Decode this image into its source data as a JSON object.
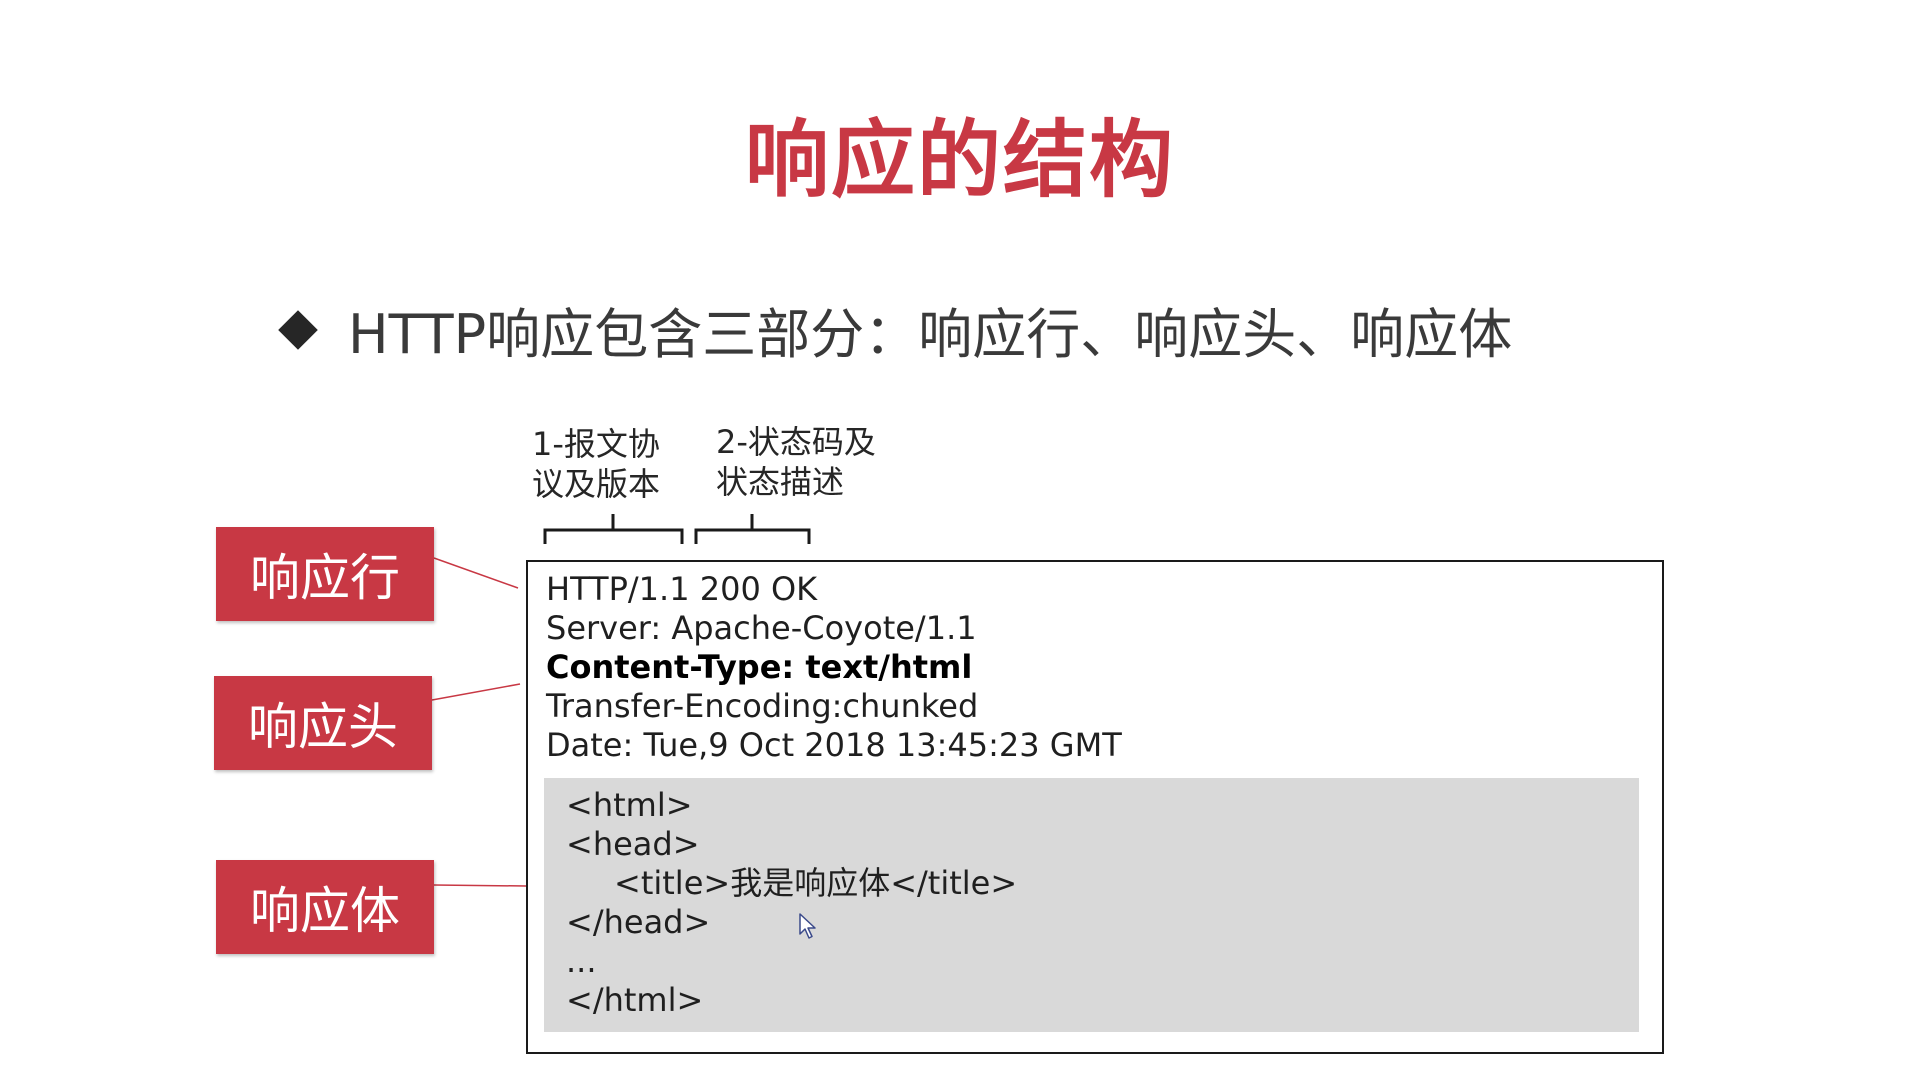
{
  "slide": {
    "title": "响应的结构",
    "bullet": "HTTP响应包含三部分：响应行、响应头、响应体",
    "annotations": {
      "protocol": [
        "1-报文协",
        "议及版本"
      ],
      "status": [
        "2-状态码及",
        "状态描述"
      ]
    },
    "labels": {
      "response_line": "响应行",
      "response_headers": "响应头",
      "response_body": "响应体"
    },
    "response": {
      "status_line": "HTTP/1.1 200 OK",
      "headers": [
        "Server: Apache-Coyote/1.1",
        "Content-Type: text/html",
        "Transfer-Encoding:chunked",
        "Date: Tue,9 Oct 2018 13:45:23 GMT"
      ],
      "body": [
        "<html>",
        "<head>",
        "<title>我是响应体</title>",
        "</head>",
        "...",
        "</html>"
      ]
    },
    "colors": {
      "accent": "#c83844",
      "body_panel": "#d9d9d9"
    },
    "icons": [
      "diamond-bullet-icon",
      "mouse-cursor-icon"
    ]
  }
}
